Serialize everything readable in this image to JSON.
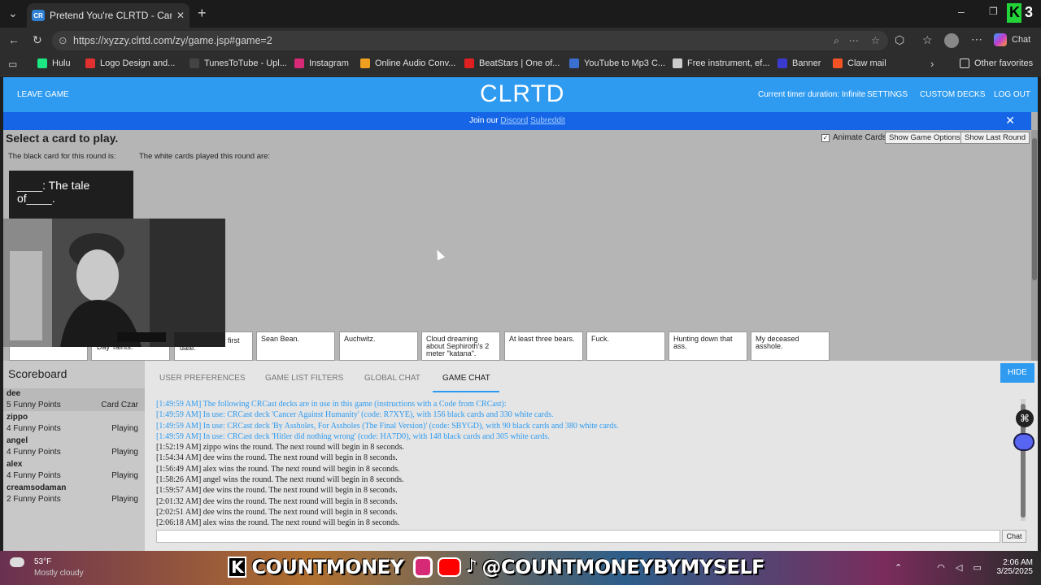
{
  "browser": {
    "tab_title": "Pretend You're CLRTD - Cards Ag",
    "tab_favicon": "CR",
    "url": "https://xyzzy.clrtd.com/zy/game.jsp#game=2",
    "chat_label": "Chat",
    "favorites": [
      {
        "label": "Hulu",
        "color": "#1ce783"
      },
      {
        "label": "Logo Design and...",
        "color": "#e03030"
      },
      {
        "label": "TunesToTube - Upl...",
        "color": "#444444"
      },
      {
        "label": "Instagram",
        "color": "#d62976"
      },
      {
        "label": "Online Audio Conv...",
        "color": "#f0a020"
      },
      {
        "label": "BeatStars | One of...",
        "color": "#e02020"
      },
      {
        "label": "YouTube to Mp3 C...",
        "color": "#3a6fd0"
      },
      {
        "label": "Free instrument, ef...",
        "color": "#cccccc"
      },
      {
        "label": "Banner",
        "color": "#3a3ad0"
      },
      {
        "label": "Claw mail",
        "color": "#f35325"
      }
    ],
    "other_favorites": "Other favorites"
  },
  "nav": {
    "leave_game": "LEAVE GAME",
    "logo": "CLRTD",
    "timer": "Current timer duration: Infinite",
    "settings": "SETTINGS",
    "custom_decks": "CUSTOM DECKS",
    "log_out": "LOG OUT"
  },
  "banner": {
    "prefix": "Join our",
    "discord": "Discord",
    "subreddit": "Subreddit",
    "close": "✕"
  },
  "game": {
    "heading": "Select a card to play.",
    "animate_cards": "Animate Cards",
    "show_game_options": "Show Game Options",
    "show_last_round": "Show Last Round",
    "black_card_caption": "The black card for this round is:",
    "white_cards_caption": "The white cards played this round are:",
    "black_card_text": "____: The tale of____.",
    "hand": [
      "",
      "Day Taints.",
      "Ghost on your first date.",
      "Sean Bean.",
      "Auchwitz.",
      "Cloud dreaming about Sephiroth's 2 meter \"katana\".",
      "At least three bears.",
      "Fuck.",
      "Hunting down that ass.",
      "My deceased asshole."
    ]
  },
  "scoreboard": {
    "title": "Scoreboard",
    "players": [
      {
        "name": "dee",
        "points": "5 Funny Points",
        "status": "Card Czar"
      },
      {
        "name": "zippo",
        "points": "4 Funny Points",
        "status": "Playing"
      },
      {
        "name": "angel",
        "points": "4 Funny Points",
        "status": "Playing"
      },
      {
        "name": "alex",
        "points": "4 Funny Points",
        "status": "Playing"
      },
      {
        "name": "creamsodaman",
        "points": "2 Funny Points",
        "status": "Playing"
      }
    ]
  },
  "panel_tabs": {
    "user_prefs": "USER PREFERENCES",
    "game_list_filters": "GAME LIST FILTERS",
    "global_chat": "GLOBAL CHAT",
    "game_chat": "GAME CHAT",
    "hide": "HIDE",
    "chat_button": "Chat"
  },
  "log": {
    "l1a": "[1:49:59 AM] The following ",
    "l1b": "CRCast",
    "l1c": " decks are in use in this game (",
    "l1d": "instructions",
    "l1e": " with a Code from ",
    "l1f": "CRCast",
    "l1g": "):",
    "l2a": "[1:49:59 AM] In use: CRCast deck 'Cancer Against Humanity' (code: ",
    "l2b": "R7XYE",
    "l2c": "), with 156 black cards and 330 white cards.",
    "l3a": "[1:49:59 AM] In use: CRCast deck 'By Assholes, For Assholes (The Final Version)' (code: ",
    "l3b": "SBYGD",
    "l3c": "), with 90 black cards and 380 white cards.",
    "l4a": "[1:49:59 AM] In use: CRCast deck 'Hitler did nothing wrong' (code: ",
    "l4b": "HA7D0",
    "l4c": "), with 148 black cards and 305 white cards.",
    "events": [
      "[1:52:19 AM] zippo wins the round. The next round will begin in 8 seconds.",
      "[1:54:34 AM] dee wins the round. The next round will begin in 8 seconds.",
      "[1:56:49 AM] alex wins the round. The next round will begin in 8 seconds.",
      "[1:58:26 AM] angel wins the round. The next round will begin in 8 seconds.",
      "[1:59:57 AM] dee wins the round. The next round will begin in 8 seconds.",
      "[2:01:32 AM] dee wins the round. The next round will begin in 8 seconds.",
      "[2:02:51 AM] dee wins the round. The next round will begin in 8 seconds.",
      "[2:06:18 AM] alex wins the round. The next round will begin in 8 seconds."
    ]
  },
  "taskbar": {
    "weather_temp": "53°F",
    "weather_desc": "Mostly cloudy",
    "overlay_name": "COUNTMONEY",
    "overlay_handle": "@COUNTMONEYBYMYSELF",
    "time": "2:06 AM",
    "date": "3/25/2025"
  }
}
